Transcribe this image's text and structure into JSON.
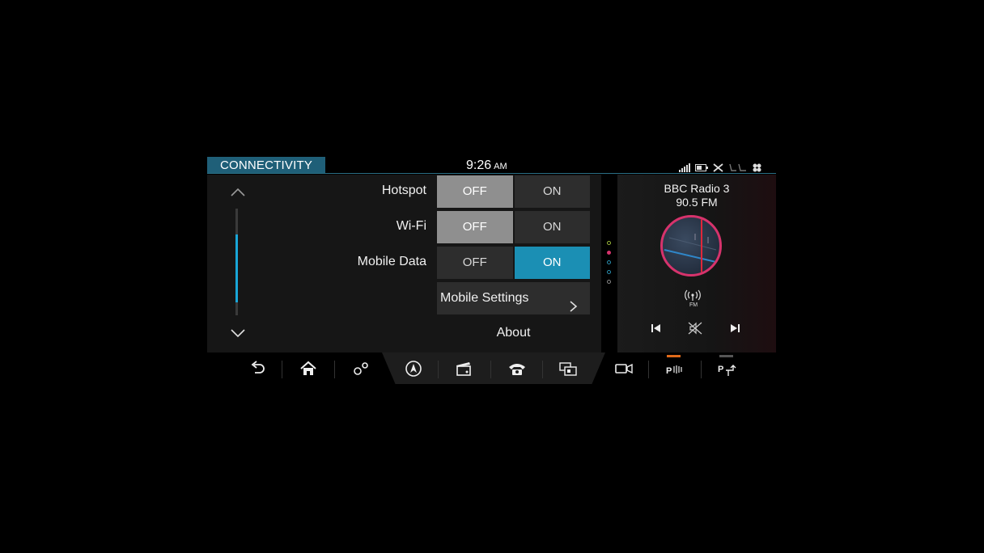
{
  "header": {
    "title": "CONNECTIVITY",
    "time": "9:26",
    "ampm": "AM",
    "status_icons": [
      "signal-icon",
      "battery-icon",
      "seat-climate-off-icon",
      "seat-icon",
      "fan-icon"
    ]
  },
  "settings": {
    "rows": [
      {
        "label": "Hotspot",
        "off": "OFF",
        "on": "ON",
        "state": "off"
      },
      {
        "label": "Wi-Fi",
        "off": "OFF",
        "on": "ON",
        "state": "off"
      },
      {
        "label": "Mobile Data",
        "off": "OFF",
        "on": "ON",
        "state": "on"
      }
    ],
    "mobile_settings": "Mobile Settings",
    "about": "About"
  },
  "media": {
    "station_name": "BBC Radio 3",
    "frequency": "90.5 FM",
    "source_icon": "fm-radio-icon",
    "band_label": "FM"
  },
  "nav": {
    "items": [
      "back-icon",
      "home-icon",
      "settings-icon",
      "navigation-icon",
      "media-icon",
      "phone-icon",
      "apps-icon",
      "camera-icon",
      "park-assist-icon",
      "park-exit-icon"
    ]
  },
  "colors": {
    "accent": "#1b8fb4",
    "title_bg": "#1f5f78",
    "dial_ring": "#d6336c",
    "park_indicator": "#e06a1a"
  }
}
